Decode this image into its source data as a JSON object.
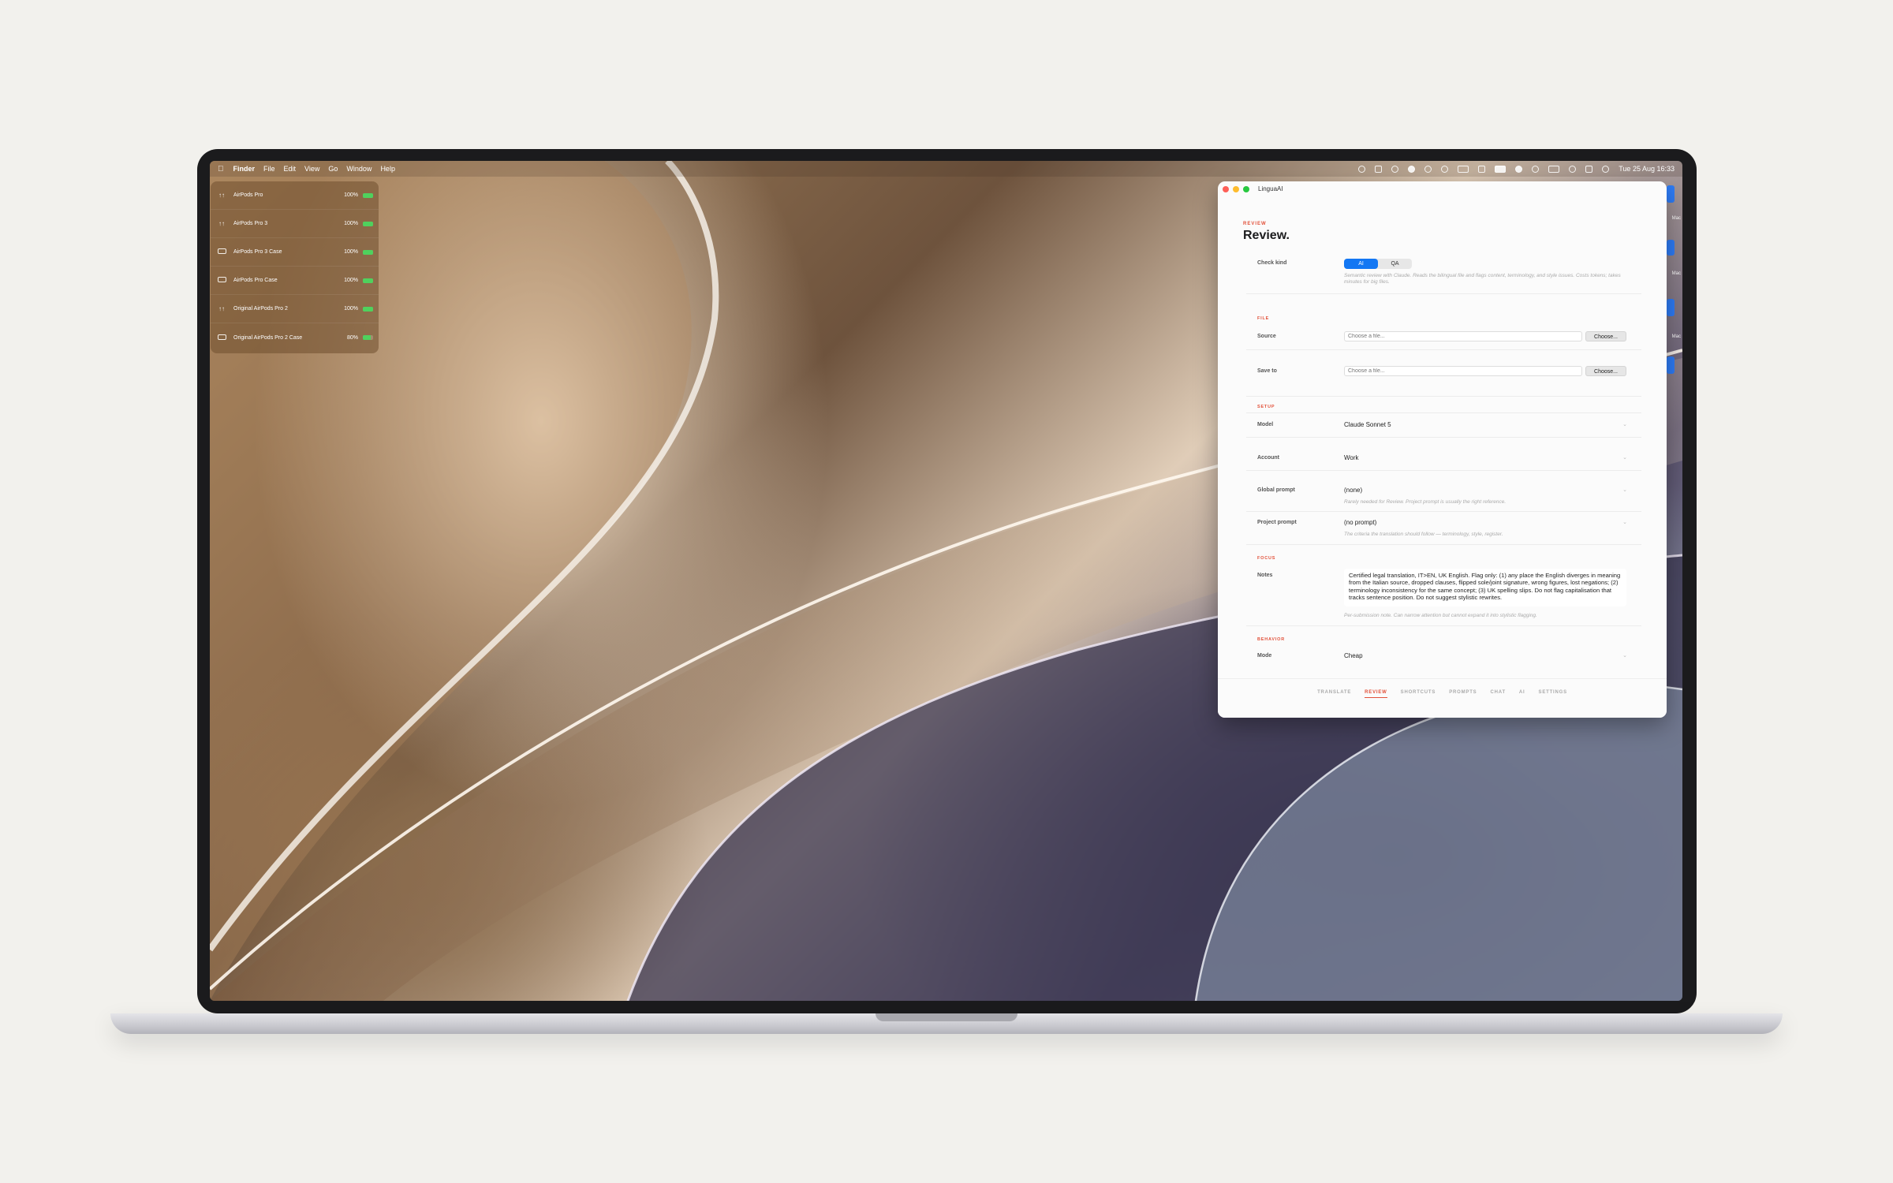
{
  "menubar": {
    "app_name": "Finder",
    "menus": [
      "File",
      "Edit",
      "View",
      "Go",
      "Window",
      "Help"
    ],
    "clock": "Tue 25 Aug  16:33"
  },
  "airpods_widget": {
    "devices": [
      {
        "name": "AirPods Pro",
        "battery": "100%",
        "level": 1.0,
        "icon": "earbuds-icon"
      },
      {
        "name": "AirPods Pro 3",
        "battery": "100%",
        "level": 1.0,
        "icon": "earbuds-icon"
      },
      {
        "name": "AirPods Pro 3 Case",
        "battery": "100%",
        "level": 1.0,
        "icon": "case-icon"
      },
      {
        "name": "AirPods Pro Case",
        "battery": "100%",
        "level": 1.0,
        "icon": "case-icon"
      },
      {
        "name": "Original AirPods Pro 2",
        "battery": "100%",
        "level": 1.0,
        "icon": "earbuds-icon"
      },
      {
        "name": "Original AirPods Pro 2 Case",
        "battery": "80%",
        "level": 0.8,
        "icon": "case-icon"
      }
    ],
    "battery_color": "#4fd15d"
  },
  "window": {
    "title": "LinguaAI",
    "kicker": "REVIEW",
    "heading": "Review.",
    "check_kind": {
      "label": "Check kind",
      "options": [
        "AI",
        "QA"
      ],
      "selected": "AI",
      "hint": "Semantic review with Claude. Reads the bilingual file and flags content, terminology, and style issues. Costs tokens; takes minutes for big files."
    },
    "file_section": {
      "heading": "FILE",
      "source": {
        "label": "Source",
        "placeholder": "Choose a file...",
        "button": "Choose..."
      },
      "save_to": {
        "label": "Save to",
        "placeholder": "Choose a file...",
        "button": "Choose..."
      }
    },
    "setup_section": {
      "heading": "SETUP",
      "model": {
        "label": "Model",
        "value": "Claude Sonnet 5"
      },
      "account": {
        "label": "Account",
        "value": "Work"
      },
      "global_prompt": {
        "label": "Global prompt",
        "value": "(none)",
        "hint": "Rarely needed for Review. Project prompt is usually the right reference."
      },
      "project_prompt": {
        "label": "Project prompt",
        "value": "(no prompt)",
        "hint": "The criteria the translation should follow — terminology, style, register."
      }
    },
    "focus_section": {
      "heading": "FOCUS",
      "notes": {
        "label": "Notes",
        "value": "Certified legal translation, IT>EN, UK English. Flag only: (1) any place the English diverges in meaning from the Italian source, dropped clauses, flipped sole/joint signature, wrong figures, lost negations; (2) terminology inconsistency for the same concept; (3) UK spelling slips. Do not flag capitalisation that tracks sentence position. Do not suggest stylistic rewrites.",
        "hint": "Per-submission note. Can narrow attention but cannot expand it into stylistic flagging."
      }
    },
    "behavior_section": {
      "heading": "BEHAVIOR",
      "mode": {
        "label": "Mode",
        "value": "Cheap"
      }
    },
    "tabs": [
      "TRANSLATE",
      "REVIEW",
      "SHORTCUTS",
      "PROMPTS",
      "CHAT",
      "AI",
      "SETTINGS"
    ],
    "active_tab": "REVIEW",
    "accent_color": "#e2513a",
    "selected_color": "#1377f3"
  },
  "right_edge_labels": [
    "Mac",
    "Mac",
    "Mac"
  ]
}
